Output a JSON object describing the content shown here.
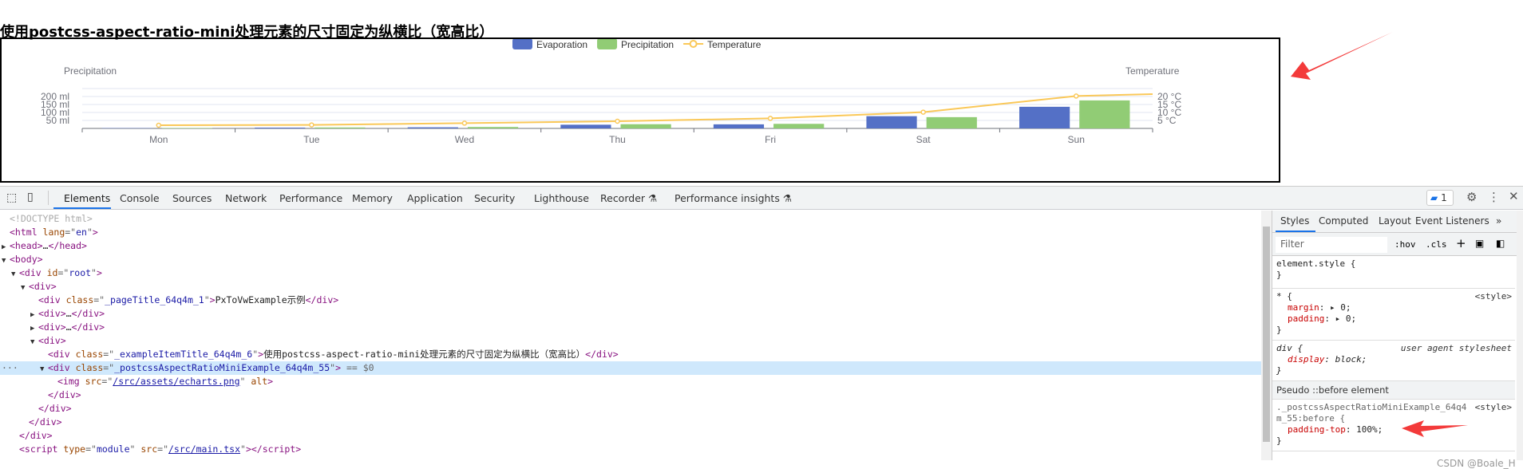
{
  "page": {
    "title": "使用postcss-aspect-ratio-mini处理元素的尺寸固定为纵横比（宽高比）"
  },
  "chart_data": {
    "type": "bar",
    "categories": [
      "Mon",
      "Tue",
      "Wed",
      "Thu",
      "Fri",
      "Sat",
      "Sun"
    ],
    "series": [
      {
        "name": "Evaporation",
        "type": "bar",
        "color": "#5470c6",
        "values": [
          2.0,
          4.9,
          7.0,
          23.2,
          25.6,
          76.7,
          135.6
        ]
      },
      {
        "name": "Precipitation",
        "type": "bar",
        "color": "#91cc75",
        "values": [
          2.6,
          5.9,
          9.0,
          26.4,
          28.7,
          70.7,
          175.6
        ]
      },
      {
        "name": "Temperature",
        "type": "line",
        "axis": "right",
        "color": "#fac858",
        "values": [
          2.0,
          2.2,
          3.3,
          4.5,
          6.3,
          10.2,
          20.3
        ]
      }
    ],
    "y_left": {
      "name": "Precipitation",
      "ticks": [
        "50 ml",
        "100 ml",
        "150 ml",
        "200 ml"
      ],
      "range": [
        0,
        250
      ]
    },
    "y_right": {
      "name": "Temperature",
      "ticks": [
        "5 °C",
        "10 °C",
        "15 °C",
        "20 °C"
      ],
      "range": [
        0,
        25
      ]
    },
    "grid": true,
    "legend": "top-center"
  },
  "devtools": {
    "tabs": [
      "Elements",
      "Console",
      "Sources",
      "Network",
      "Performance",
      "Memory",
      "Application",
      "Security",
      "Lighthouse",
      "Recorder ⚗",
      "Performance insights ⚗"
    ],
    "active_tab": "Elements",
    "issues_count": "1",
    "tree": [
      {
        "i": 0,
        "s": [
          [
            "com",
            "<!DOCTYPE html>"
          ]
        ]
      },
      {
        "i": 0,
        "s": [
          [
            "tag",
            "<html "
          ],
          [
            "attr",
            "lang"
          ],
          [
            "eq",
            "=\""
          ],
          [
            "val",
            "en"
          ],
          [
            "eq",
            "\""
          ],
          [
            "tag",
            ">"
          ]
        ]
      },
      {
        "i": 0,
        "t": "▶",
        "s": [
          [
            "tag",
            "<head>"
          ],
          [
            "txt",
            "…"
          ],
          [
            "tag",
            "</head>"
          ]
        ]
      },
      {
        "i": 0,
        "t": "▼",
        "s": [
          [
            "tag",
            "<body>"
          ]
        ]
      },
      {
        "i": 1,
        "t": "▼",
        "s": [
          [
            "tag",
            "<div "
          ],
          [
            "attr",
            "id"
          ],
          [
            "eq",
            "=\""
          ],
          [
            "val",
            "root"
          ],
          [
            "eq",
            "\""
          ],
          [
            "tag",
            ">"
          ]
        ]
      },
      {
        "i": 2,
        "t": "▼",
        "s": [
          [
            "tag",
            "<div>"
          ]
        ]
      },
      {
        "i": 3,
        "s": [
          [
            "tag",
            "<div "
          ],
          [
            "attr",
            "class"
          ],
          [
            "eq",
            "=\""
          ],
          [
            "val",
            "_pageTitle_64q4m_1"
          ],
          [
            "eq",
            "\""
          ],
          [
            "tag",
            ">"
          ],
          [
            "txt",
            "PxToVwExample示例"
          ],
          [
            "tag",
            "</div>"
          ]
        ]
      },
      {
        "i": 3,
        "t": "▶",
        "s": [
          [
            "tag",
            "<div>"
          ],
          [
            "txt",
            "…"
          ],
          [
            "tag",
            "</div>"
          ]
        ]
      },
      {
        "i": 3,
        "t": "▶",
        "s": [
          [
            "tag",
            "<div>"
          ],
          [
            "txt",
            "…"
          ],
          [
            "tag",
            "</div>"
          ]
        ]
      },
      {
        "i": 3,
        "t": "▼",
        "s": [
          [
            "tag",
            "<div>"
          ]
        ]
      },
      {
        "i": 4,
        "s": [
          [
            "tag",
            "<div "
          ],
          [
            "attr",
            "class"
          ],
          [
            "eq",
            "=\""
          ],
          [
            "val",
            "_exampleItemTitle_64q4m_6"
          ],
          [
            "eq",
            "\""
          ],
          [
            "tag",
            ">"
          ],
          [
            "txt",
            "使用postcss-aspect-ratio-mini处理元素的尺寸固定为纵横比（宽高比）"
          ],
          [
            "tag",
            "</div>"
          ]
        ]
      },
      {
        "i": 4,
        "t": "▼",
        "sel": true,
        "s": [
          [
            "tag",
            "<div "
          ],
          [
            "attr",
            "class"
          ],
          [
            "eq",
            "=\""
          ],
          [
            "val",
            "_postcssAspectRatioMiniExample_64q4m_55"
          ],
          [
            "eq",
            "\""
          ],
          [
            "tag",
            ">"
          ],
          [
            "eq",
            " == $0"
          ]
        ]
      },
      {
        "i": 5,
        "s": [
          [
            "tag",
            "<img "
          ],
          [
            "attr",
            "src"
          ],
          [
            "eq",
            "=\""
          ],
          [
            "link",
            "/src/assets/echarts.png"
          ],
          [
            "eq",
            "\" "
          ],
          [
            "attr",
            "alt"
          ],
          [
            "tag",
            ">"
          ]
        ]
      },
      {
        "i": 4,
        "s": [
          [
            "tag",
            "</div>"
          ]
        ]
      },
      {
        "i": 3,
        "s": [
          [
            "tag",
            "</div>"
          ]
        ]
      },
      {
        "i": 2,
        "s": [
          [
            "tag",
            "</div>"
          ]
        ]
      },
      {
        "i": 1,
        "s": [
          [
            "tag",
            "</div>"
          ]
        ]
      },
      {
        "i": 1,
        "s": [
          [
            "tag",
            "<script "
          ],
          [
            "attr",
            "type"
          ],
          [
            "eq",
            "=\""
          ],
          [
            "val",
            "module"
          ],
          [
            "eq",
            "\" "
          ],
          [
            "attr",
            "src"
          ],
          [
            "eq",
            "=\""
          ],
          [
            "link",
            "/src/main.tsx"
          ],
          [
            "eq",
            "\""
          ],
          [
            "tag",
            "></script>"
          ]
        ]
      }
    ],
    "styles": {
      "tabs": [
        "Styles",
        "Computed",
        "Layout",
        "Event Listeners",
        "»"
      ],
      "filter_placeholder": "Filter",
      "hov": ":hov",
      "cls": ".cls",
      "plus": "+",
      "r1": {
        "sel": "element.style {",
        "end": "}"
      },
      "r2": {
        "sel": "* {",
        "src": "<style>",
        "p1": "margin",
        "v1": "▸ 0;",
        "p2": "padding",
        "v2": "▸ 0;",
        "end": "}"
      },
      "r3": {
        "sel": "div {",
        "src": "user agent stylesheet",
        "p1": "display",
        "v1": "block;",
        "end": "}"
      },
      "pseudo": "Pseudo ::before element",
      "r4": {
        "sel1": "._postcssAspectRatioMiniExample_64q4",
        "sel2": "m_55:before {",
        "src": "<style>",
        "p1": "padding-top",
        "v1": "100%;",
        "end": "}"
      }
    }
  },
  "watermark": "CSDN @Boale_H",
  "colors": {
    "annotation_arrow": "#f33a3a",
    "accent": "#1a73e8"
  }
}
